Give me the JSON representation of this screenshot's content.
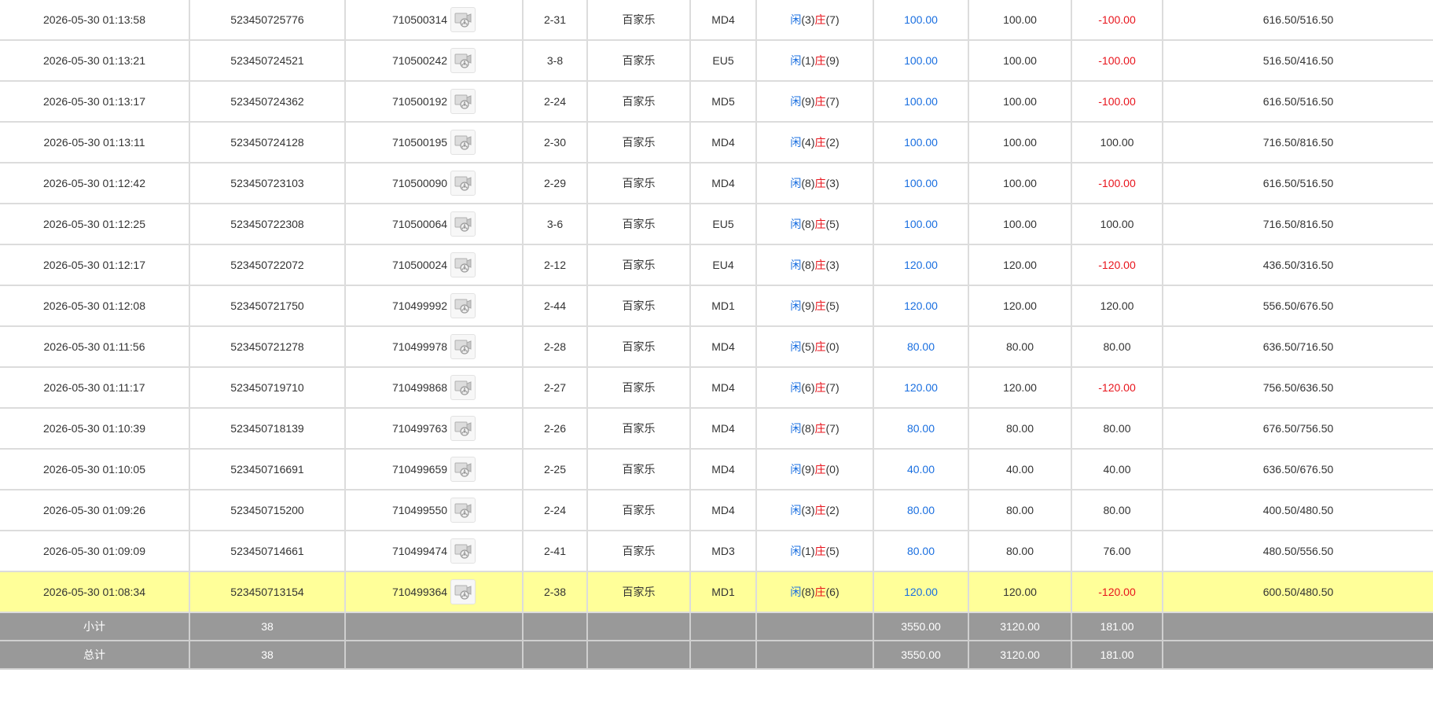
{
  "table": {
    "rows": [
      {
        "time": "2026-05-30 01:13:58",
        "bet_id": "523450725776",
        "round_id": "710500314",
        "shoe": "2-31",
        "game": "百家乐",
        "table": "MD4",
        "result": {
          "player_label": "闲",
          "player_points": "(3)",
          "banker_label": "庄",
          "banker_points": "(7)"
        },
        "bet": "100.00",
        "valid_bet": "100.00",
        "win_loss": "-100.00",
        "win_loss_negative": true,
        "balance": "616.50/516.50"
      },
      {
        "time": "2026-05-30 01:13:21",
        "bet_id": "523450724521",
        "round_id": "710500242",
        "shoe": "3-8",
        "game": "百家乐",
        "table": "EU5",
        "result": {
          "player_label": "闲",
          "player_points": "(1)",
          "banker_label": "庄",
          "banker_points": "(9)"
        },
        "bet": "100.00",
        "valid_bet": "100.00",
        "win_loss": "-100.00",
        "win_loss_negative": true,
        "balance": "516.50/416.50"
      },
      {
        "time": "2026-05-30 01:13:17",
        "bet_id": "523450724362",
        "round_id": "710500192",
        "shoe": "2-24",
        "game": "百家乐",
        "table": "MD5",
        "result": {
          "player_label": "闲",
          "player_points": "(9)",
          "banker_label": "庄",
          "banker_points": "(7)"
        },
        "bet": "100.00",
        "valid_bet": "100.00",
        "win_loss": "-100.00",
        "win_loss_negative": true,
        "balance": "616.50/516.50"
      },
      {
        "time": "2026-05-30 01:13:11",
        "bet_id": "523450724128",
        "round_id": "710500195",
        "shoe": "2-30",
        "game": "百家乐",
        "table": "MD4",
        "result": {
          "player_label": "闲",
          "player_points": "(4)",
          "banker_label": "庄",
          "banker_points": "(2)"
        },
        "bet": "100.00",
        "valid_bet": "100.00",
        "win_loss": "100.00",
        "win_loss_negative": false,
        "balance": "716.50/816.50"
      },
      {
        "time": "2026-05-30 01:12:42",
        "bet_id": "523450723103",
        "round_id": "710500090",
        "shoe": "2-29",
        "game": "百家乐",
        "table": "MD4",
        "result": {
          "player_label": "闲",
          "player_points": "(8)",
          "banker_label": "庄",
          "banker_points": "(3)"
        },
        "bet": "100.00",
        "valid_bet": "100.00",
        "win_loss": "-100.00",
        "win_loss_negative": true,
        "balance": "616.50/516.50"
      },
      {
        "time": "2026-05-30 01:12:25",
        "bet_id": "523450722308",
        "round_id": "710500064",
        "shoe": "3-6",
        "game": "百家乐",
        "table": "EU5",
        "result": {
          "player_label": "闲",
          "player_points": "(8)",
          "banker_label": "庄",
          "banker_points": "(5)"
        },
        "bet": "100.00",
        "valid_bet": "100.00",
        "win_loss": "100.00",
        "win_loss_negative": false,
        "balance": "716.50/816.50"
      },
      {
        "time": "2026-05-30 01:12:17",
        "bet_id": "523450722072",
        "round_id": "710500024",
        "shoe": "2-12",
        "game": "百家乐",
        "table": "EU4",
        "result": {
          "player_label": "闲",
          "player_points": "(8)",
          "banker_label": "庄",
          "banker_points": "(3)"
        },
        "bet": "120.00",
        "valid_bet": "120.00",
        "win_loss": "-120.00",
        "win_loss_negative": true,
        "balance": "436.50/316.50"
      },
      {
        "time": "2026-05-30 01:12:08",
        "bet_id": "523450721750",
        "round_id": "710499992",
        "shoe": "2-44",
        "game": "百家乐",
        "table": "MD1",
        "result": {
          "player_label": "闲",
          "player_points": "(9)",
          "banker_label": "庄",
          "banker_points": "(5)"
        },
        "bet": "120.00",
        "valid_bet": "120.00",
        "win_loss": "120.00",
        "win_loss_negative": false,
        "balance": "556.50/676.50"
      },
      {
        "time": "2026-05-30 01:11:56",
        "bet_id": "523450721278",
        "round_id": "710499978",
        "shoe": "2-28",
        "game": "百家乐",
        "table": "MD4",
        "result": {
          "player_label": "闲",
          "player_points": "(5)",
          "banker_label": "庄",
          "banker_points": "(0)"
        },
        "bet": "80.00",
        "valid_bet": "80.00",
        "win_loss": "80.00",
        "win_loss_negative": false,
        "balance": "636.50/716.50"
      },
      {
        "time": "2026-05-30 01:11:17",
        "bet_id": "523450719710",
        "round_id": "710499868",
        "shoe": "2-27",
        "game": "百家乐",
        "table": "MD4",
        "result": {
          "player_label": "闲",
          "player_points": "(6)",
          "banker_label": "庄",
          "banker_points": "(7)"
        },
        "bet": "120.00",
        "valid_bet": "120.00",
        "win_loss": "-120.00",
        "win_loss_negative": true,
        "balance": "756.50/636.50"
      },
      {
        "time": "2026-05-30 01:10:39",
        "bet_id": "523450718139",
        "round_id": "710499763",
        "shoe": "2-26",
        "game": "百家乐",
        "table": "MD4",
        "result": {
          "player_label": "闲",
          "player_points": "(8)",
          "banker_label": "庄",
          "banker_points": "(7)"
        },
        "bet": "80.00",
        "valid_bet": "80.00",
        "win_loss": "80.00",
        "win_loss_negative": false,
        "balance": "676.50/756.50"
      },
      {
        "time": "2026-05-30 01:10:05",
        "bet_id": "523450716691",
        "round_id": "710499659",
        "shoe": "2-25",
        "game": "百家乐",
        "table": "MD4",
        "result": {
          "player_label": "闲",
          "player_points": "(9)",
          "banker_label": "庄",
          "banker_points": "(0)"
        },
        "bet": "40.00",
        "valid_bet": "40.00",
        "win_loss": "40.00",
        "win_loss_negative": false,
        "balance": "636.50/676.50"
      },
      {
        "time": "2026-05-30 01:09:26",
        "bet_id": "523450715200",
        "round_id": "710499550",
        "shoe": "2-24",
        "game": "百家乐",
        "table": "MD4",
        "result": {
          "player_label": "闲",
          "player_points": "(3)",
          "banker_label": "庄",
          "banker_points": "(2)"
        },
        "bet": "80.00",
        "valid_bet": "80.00",
        "win_loss": "80.00",
        "win_loss_negative": false,
        "balance": "400.50/480.50"
      },
      {
        "time": "2026-05-30 01:09:09",
        "bet_id": "523450714661",
        "round_id": "710499474",
        "shoe": "2-41",
        "game": "百家乐",
        "table": "MD3",
        "result": {
          "player_label": "闲",
          "player_points": "(1)",
          "banker_label": "庄",
          "banker_points": "(5)"
        },
        "bet": "80.00",
        "valid_bet": "80.00",
        "win_loss": "76.00",
        "win_loss_negative": false,
        "balance": "480.50/556.50"
      },
      {
        "time": "2026-05-30 01:08:34",
        "bet_id": "523450713154",
        "round_id": "710499364",
        "shoe": "2-38",
        "game": "百家乐",
        "table": "MD1",
        "result": {
          "player_label": "闲",
          "player_points": "(8)",
          "banker_label": "庄",
          "banker_points": "(6)"
        },
        "bet": "120.00",
        "valid_bet": "120.00",
        "win_loss": "-120.00",
        "win_loss_negative": true,
        "balance": "600.50/480.50",
        "highlighted": true
      }
    ],
    "subtotal": {
      "label": "小计",
      "count": "38",
      "bet": "3550.00",
      "valid_bet": "3120.00",
      "win_loss": "181.00"
    },
    "total": {
      "label": "总计",
      "count": "38",
      "bet": "3550.00",
      "valid_bet": "3120.00",
      "win_loss": "181.00"
    }
  },
  "colors": {
    "player": "#1a6fe0",
    "banker": "#e8141c",
    "negative": "#e8141c",
    "bet": "#1a6fe0",
    "highlight_row": "#ffff99",
    "summary_row": "#999999"
  },
  "icons": {
    "replay": "video-replay-icon"
  }
}
